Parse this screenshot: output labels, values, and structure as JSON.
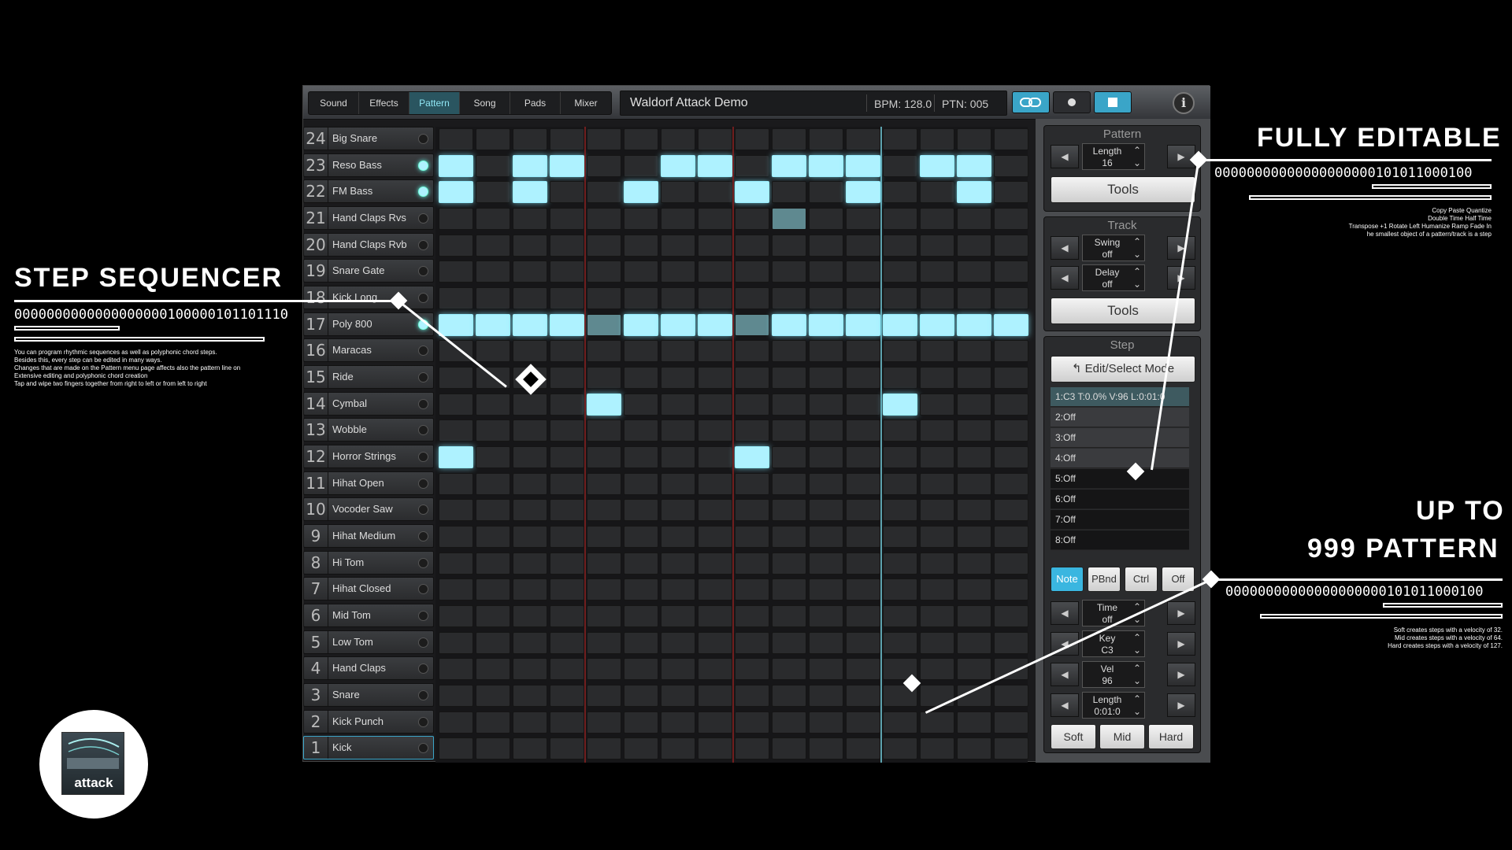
{
  "tabs": [
    "Sound",
    "Effects",
    "Pattern",
    "Song",
    "Pads",
    "Mixer"
  ],
  "active_tab": 2,
  "song_title": "Waldorf Attack Demo",
  "bpm": "BPM: 128.0",
  "ptn": "PTN: 005",
  "tracks": [
    {
      "num": "24",
      "name": "Big Snare",
      "led": false,
      "steps": []
    },
    {
      "num": "23",
      "name": "Reso Bass",
      "led": true,
      "steps": [
        0,
        2,
        3,
        6,
        7,
        9,
        10,
        11,
        13,
        14
      ]
    },
    {
      "num": "22",
      "name": "FM Bass",
      "led": true,
      "steps": [
        0,
        2,
        5,
        8,
        11,
        14
      ]
    },
    {
      "num": "21",
      "name": "Hand Claps Rvs",
      "led": false,
      "steps": [],
      "dim": [
        9
      ]
    },
    {
      "num": "20",
      "name": "Hand Claps Rvb",
      "led": false,
      "steps": []
    },
    {
      "num": "19",
      "name": "Snare Gate",
      "led": false,
      "steps": []
    },
    {
      "num": "18",
      "name": "Kick Long",
      "led": false,
      "steps": []
    },
    {
      "num": "17",
      "name": "Poly 800",
      "led": true,
      "steps": [
        0,
        1,
        2,
        3,
        5,
        6,
        7,
        9,
        10,
        11,
        12,
        13,
        14,
        15
      ],
      "dim": [
        4,
        8
      ]
    },
    {
      "num": "16",
      "name": "Maracas",
      "led": false,
      "steps": []
    },
    {
      "num": "15",
      "name": "Ride",
      "led": false,
      "steps": []
    },
    {
      "num": "14",
      "name": "Cymbal",
      "led": false,
      "steps": [
        4,
        12
      ]
    },
    {
      "num": "13",
      "name": "Wobble",
      "led": false,
      "steps": []
    },
    {
      "num": "12",
      "name": "Horror Strings",
      "led": false,
      "steps": [
        0,
        8
      ]
    },
    {
      "num": "11",
      "name": "Hihat Open",
      "led": false,
      "steps": []
    },
    {
      "num": "10",
      "name": "Vocoder Saw",
      "led": false,
      "steps": []
    },
    {
      "num": "9",
      "name": "Hihat Medium",
      "led": false,
      "steps": []
    },
    {
      "num": "8",
      "name": "Hi Tom",
      "led": false,
      "steps": []
    },
    {
      "num": "7",
      "name": "Hihat Closed",
      "led": false,
      "steps": []
    },
    {
      "num": "6",
      "name": "Mid Tom",
      "led": false,
      "steps": []
    },
    {
      "num": "5",
      "name": "Low Tom",
      "led": false,
      "steps": []
    },
    {
      "num": "4",
      "name": "Hand Claps",
      "led": false,
      "steps": []
    },
    {
      "num": "3",
      "name": "Snare",
      "led": false,
      "steps": []
    },
    {
      "num": "2",
      "name": "Kick Punch",
      "led": false,
      "steps": []
    },
    {
      "num": "1",
      "name": "Kick",
      "led": false,
      "steps": [],
      "selected": true
    }
  ],
  "grid_colors": {
    "active": "#aef2ff",
    "bar_line": "#7a1f1f",
    "playhead": "#6fc7d6",
    "accent": "#3aa5c8"
  },
  "panel": {
    "pattern_title": "Pattern",
    "track_title": "Track",
    "step_title": "Step",
    "tools_label": "Tools",
    "pattern_length": {
      "label": "Length",
      "value": "16"
    },
    "swing": {
      "label": "Swing",
      "value": "off"
    },
    "delay": {
      "label": "Delay",
      "value": "off"
    },
    "edit_mode": "Edit/Select Mode",
    "step_list": [
      "1:C3 T:0.0% V:96 L:0:01:0",
      "2:Off",
      "3:Off",
      "4:Off",
      "5:Off",
      "6:Off",
      "7:Off",
      "8:Off"
    ],
    "modes": [
      "Note",
      "PBnd",
      "Ctrl",
      "Off"
    ],
    "active_mode": 0,
    "time": {
      "label": "Time",
      "value": "off"
    },
    "key": {
      "label": "Key",
      "value": "C3"
    },
    "vel": {
      "label": "Vel",
      "value": "96"
    },
    "step_length": {
      "label": "Length",
      "value": "0:01:0"
    },
    "velocity_buttons": [
      "Soft",
      "Mid",
      "Hard"
    ]
  },
  "annotations": {
    "step_sequencer": {
      "title": "STEP SEQUENCER",
      "binary": "0000000000000000000100000101101110",
      "notes": [
        "You can program rhythmic sequences as well as polyphonic chord steps.",
        "Besides this, every step can be edited in many ways.",
        "Changes that are made on the Pattern menu page affects also the pattern line on",
        "Extensive editing and polyphonic chord creation",
        "Tap and wipe two fingers together from right to left or from left to right"
      ]
    },
    "fully_editable": {
      "title": "FULLY EDITABLE",
      "binary": "00000000000000000000101011000100",
      "notes": [
        "Copy Paste Quantize",
        "Double Time Half Time",
        "Transpose +1 Rotate Left Humanize Ramp Fade In",
        "he smallest object of a pattern/track is a step"
      ]
    },
    "up_to": {
      "title_line1": "UP TO",
      "title_line2": "999 PATTERN",
      "binary": "00000000000000000000101011000100",
      "notes": [
        "Soft creates steps with a velocity of 32.",
        "Mid creates steps with a velocity of 64.",
        "Hard creates steps with a velocity of 127."
      ]
    }
  },
  "logo_text": "attack"
}
